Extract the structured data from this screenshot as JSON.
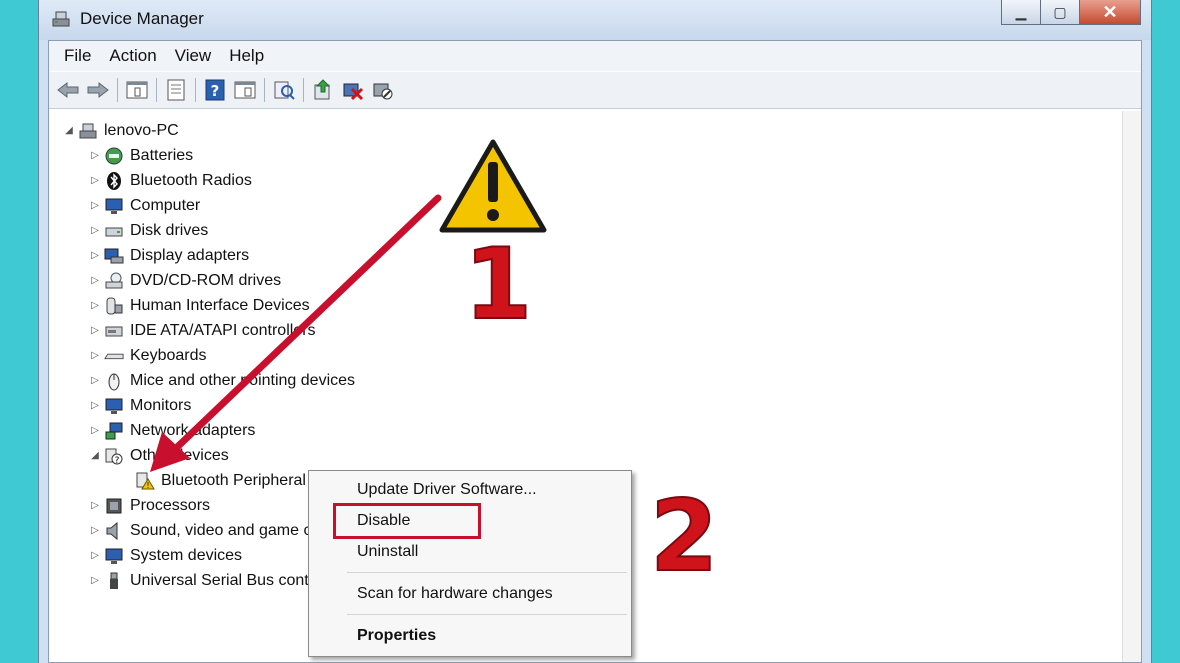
{
  "window": {
    "title": "Device Manager",
    "controls": {
      "minimize": "▁",
      "maximize": "▢",
      "close": "✕"
    }
  },
  "menu": [
    "File",
    "Action",
    "View",
    "Help"
  ],
  "toolbar_icons": [
    "back-icon",
    "forward-icon",
    "sep",
    "properties-icon",
    "sep",
    "help-list-icon",
    "sep",
    "help-icon",
    "view-icon",
    "sep",
    "scan-icon",
    "sep",
    "update-driver-icon",
    "uninstall-icon",
    "disable-icon"
  ],
  "tree": {
    "root": "lenovo-PC",
    "nodes": [
      {
        "label": "Batteries",
        "icon": "battery-icon",
        "expanded": false
      },
      {
        "label": "Bluetooth Radios",
        "icon": "bluetooth-icon",
        "expanded": false
      },
      {
        "label": "Computer",
        "icon": "computer-icon",
        "expanded": false
      },
      {
        "label": "Disk drives",
        "icon": "disk-drive-icon",
        "expanded": false
      },
      {
        "label": "Display adapters",
        "icon": "display-adapter-icon",
        "expanded": false
      },
      {
        "label": "DVD/CD-ROM drives",
        "icon": "dvd-drive-icon",
        "expanded": false
      },
      {
        "label": "Human Interface Devices",
        "icon": "hid-icon",
        "expanded": false
      },
      {
        "label": "IDE ATA/ATAPI controllers",
        "icon": "ide-controller-icon",
        "expanded": false
      },
      {
        "label": "Keyboards",
        "icon": "keyboard-icon",
        "expanded": false
      },
      {
        "label": "Mice and other pointing devices",
        "icon": "mouse-icon",
        "expanded": false
      },
      {
        "label": "Monitors",
        "icon": "monitor-icon",
        "expanded": false
      },
      {
        "label": "Network adapters",
        "icon": "network-adapter-icon",
        "expanded": false
      },
      {
        "label": "Other devices",
        "icon": "other-devices-icon",
        "expanded": true
      },
      {
        "label": "Bluetooth Peripheral Device",
        "icon": "warning-device-icon",
        "child": true
      },
      {
        "label": "Processors",
        "icon": "processor-icon",
        "expanded": false
      },
      {
        "label": "Sound, video and game controllers",
        "icon": "sound-icon",
        "expanded": false
      },
      {
        "label": "System devices",
        "icon": "system-devices-icon",
        "expanded": false
      },
      {
        "label": "Universal Serial Bus controllers",
        "icon": "usb-icon",
        "expanded": false
      }
    ]
  },
  "context_menu": {
    "update": "Update Driver Software...",
    "disable": "Disable",
    "uninstall": "Uninstall",
    "scan": "Scan for hardware changes",
    "properties": "Properties"
  },
  "annotations": {
    "step1": "1",
    "step2": "2",
    "arrow_color": "#c8102e",
    "warning_color": "#f5c400"
  }
}
